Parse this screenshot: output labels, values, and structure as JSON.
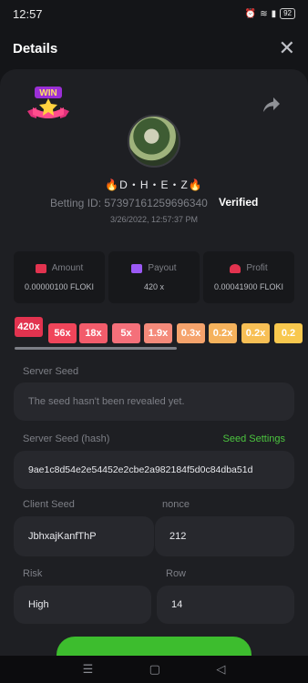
{
  "status_bar": {
    "time": "12:57",
    "battery": "92"
  },
  "header": {
    "title": "Details",
    "close_icon": "close-icon"
  },
  "bet": {
    "username": "🔥D・H・E・Z🔥",
    "betting_id": "Betting ID: 57397161259696340",
    "verified": "Verified",
    "timestamp": "3/26/2022, 12:57:37 PM"
  },
  "stats": [
    {
      "label": "Amount",
      "value": "0.00000100 FLOKI",
      "icon": "wallet-icon",
      "color": "#e2334f"
    },
    {
      "label": "Payout",
      "value": "420 x",
      "icon": "card-icon",
      "color": "#9b59f5"
    },
    {
      "label": "Profit",
      "value": "0.00041900 FLOKI",
      "icon": "profit-icon",
      "color": "#e2334f"
    }
  ],
  "multipliers": [
    {
      "label": "420x",
      "color": "#e2334f"
    },
    {
      "label": "56x",
      "color": "#f0455a"
    },
    {
      "label": "18x",
      "color": "#f25c6b"
    },
    {
      "label": "5x",
      "color": "#f4707a"
    },
    {
      "label": "1.9x",
      "color": "#f48a7a"
    },
    {
      "label": "0.3x",
      "color": "#f5a36c"
    },
    {
      "label": "0.2x",
      "color": "#f5b25c"
    },
    {
      "label": "0.2x",
      "color": "#f7bf55"
    },
    {
      "label": "0.2",
      "color": "#f8c84e"
    }
  ],
  "fields": {
    "server_seed_label": "Server Seed",
    "server_seed_value": "The seed hasn't been revealed yet.",
    "server_seed_hash_label": "Server Seed (hash)",
    "seed_settings": "Seed Settings",
    "server_seed_hash_value": "9ae1c8d54e2e54452e2cbe2a982184f5d0c84dba51d",
    "client_seed_label": "Client Seed",
    "client_seed_value": "JbhxajKanfThP",
    "nonce_label": "nonce",
    "nonce_value": "212",
    "risk_label": "Risk",
    "risk_value": "High",
    "row_label": "Row",
    "row_value": "14"
  },
  "nav": {
    "menu": "☰",
    "home": "▢",
    "back": "◁"
  }
}
